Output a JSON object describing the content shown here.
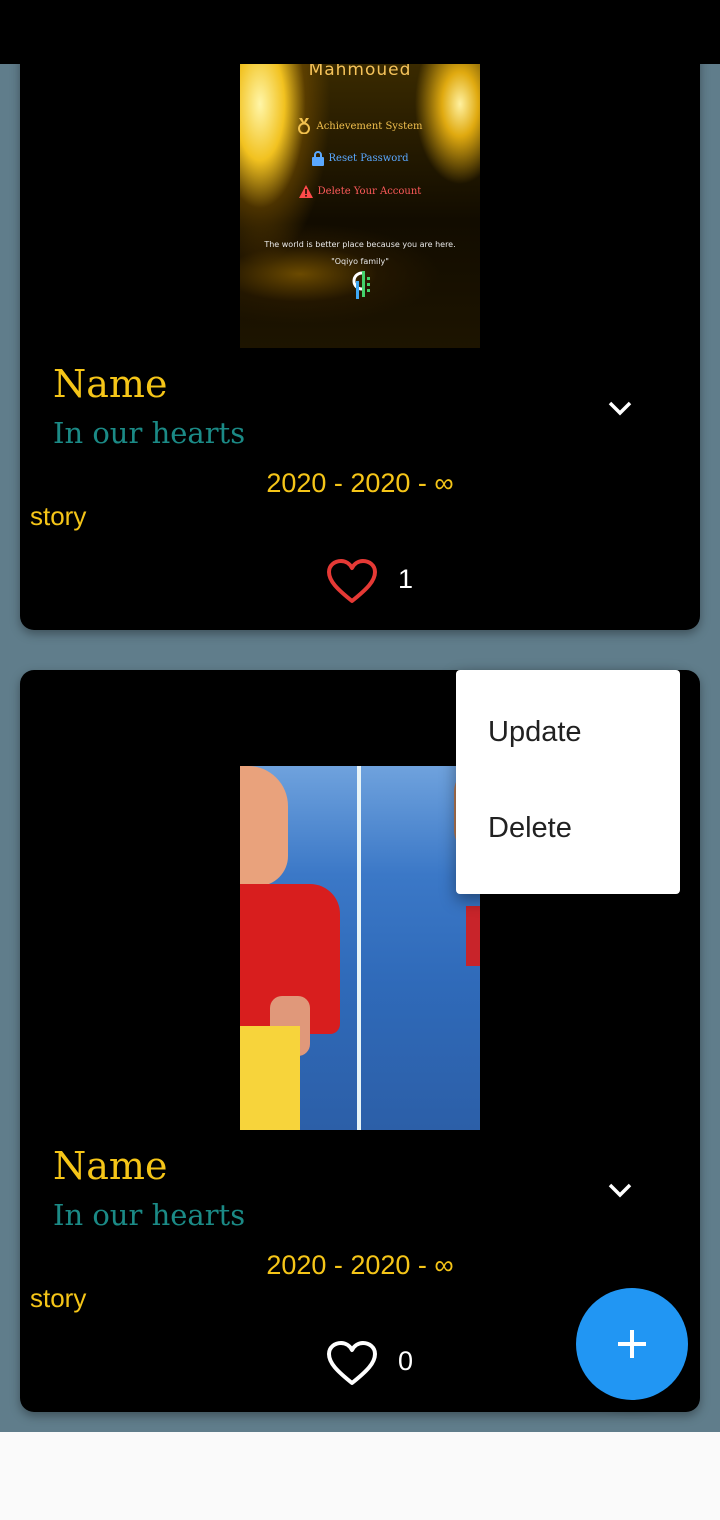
{
  "colors": {
    "page_background": "#607d8b",
    "card_background": "#000000",
    "name_color": "#f5c518",
    "subtitle_color": "#1b8a86",
    "heart_liked": "#e53935",
    "heart_default": "#ffffff",
    "fab_color": "#2196f3"
  },
  "cards": [
    {
      "photo_overlay": {
        "user_name": "Mahmoued",
        "achievement": "Achievement System",
        "reset_password": "Reset Password",
        "delete_account": "Delete Your Account",
        "quote_line1": "The world is better place because you are here.",
        "quote_line2": "\"Oqiyo family\""
      },
      "name": "Name",
      "subtitle": "In our hearts",
      "dates": "2020 - 2020 - ∞",
      "story": "story",
      "likes": "1",
      "liked": true
    },
    {
      "name": "Name",
      "subtitle": "In our hearts",
      "dates": "2020 - 2020 - ∞",
      "story": "story",
      "likes": "0",
      "liked": false
    }
  ],
  "popup_menu": {
    "items": [
      "Update",
      "Delete"
    ]
  },
  "fab": {
    "icon": "plus-icon"
  }
}
